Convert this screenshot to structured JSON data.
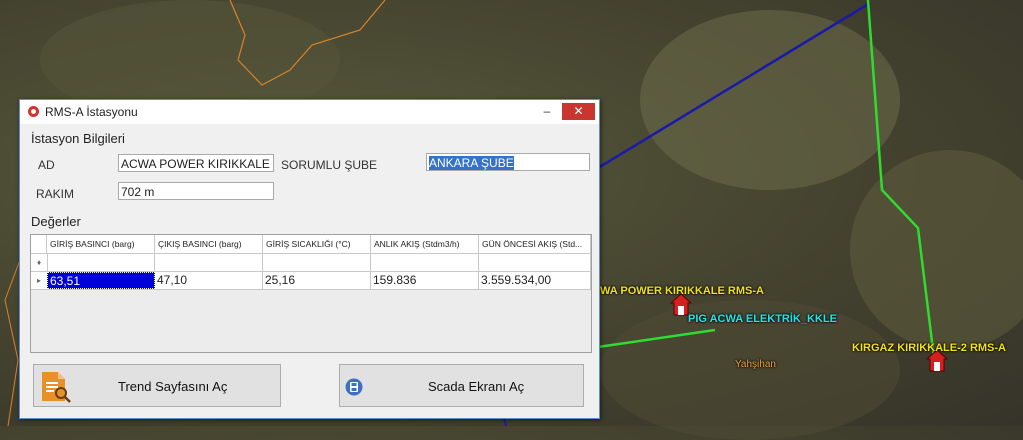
{
  "map": {
    "labels": {
      "acwa_station": "WA POWER KIRIKKALE RMS-A",
      "pig": "PIG ACWA ELEKTRİK_KKLE",
      "kirgaz_station": "KIRGAZ KIRIKKALE-2 RMS-A",
      "yahsihan": "Yahşihan"
    },
    "colors": {
      "blue_line": "#1a1aa8",
      "green_line": "#2fdc2f",
      "orange_boundary": "#d9822b"
    }
  },
  "dialog": {
    "title": "RMS-A İstasyonu",
    "min_symbol": "‒",
    "close_symbol": "✕",
    "info_section": "İstasyon Bilgileri",
    "fields": {
      "ad_label": "AD",
      "ad_value": "ACWA POWER KIRIKKALE",
      "sube_label": "SORUMLU ŞUBE",
      "sube_value": "ANKARA ŞUBE",
      "rakim_label": "RAKIM",
      "rakim_value": "702 m"
    },
    "values_section": "Değerler",
    "grid": {
      "columns": [
        "GİRİŞ BASINCI (barg)",
        "ÇIKIŞ BASINCI (barg)",
        "GİRİŞ SICAKLIĞI (°C)",
        "ANLIK AKIŞ (Stdm3/h)",
        "GÜN ÖNCESİ AKIŞ (Std..."
      ],
      "new_row_marker": "♦",
      "row_marker": "▸",
      "rows": [
        [
          "63,51",
          "47,10",
          "25,16",
          "159.836",
          "3.559.534,00"
        ]
      ]
    },
    "buttons": {
      "trend": "Trend Sayfasını Aç",
      "scada": "Scada Ekranı Aç"
    }
  }
}
